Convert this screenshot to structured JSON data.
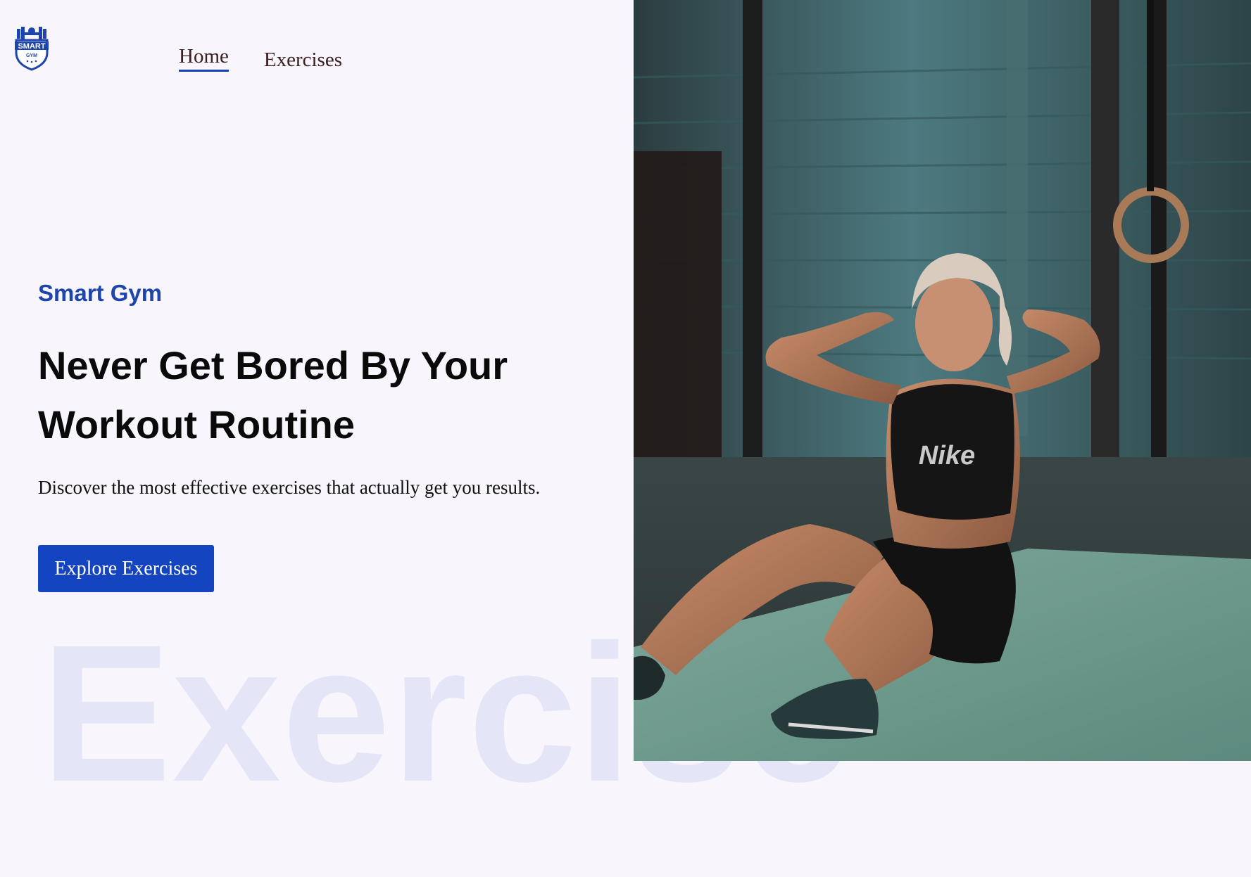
{
  "logo": {
    "text_top": "SMART",
    "text_bottom": "GYM",
    "color": "#1e44ad"
  },
  "nav": {
    "items": [
      {
        "label": "Home",
        "active": true
      },
      {
        "label": "Exercises",
        "active": false
      }
    ]
  },
  "hero": {
    "brand": "Smart Gym",
    "headline_line1": "Never Get Bored By Your",
    "headline_line2": "Workout Routine",
    "description": "Discover the most effective exercises that actually get you results.",
    "cta_label": "Explore Exercises",
    "watermark": "Exercise"
  },
  "photo": {
    "subject": "woman doing sit-ups on gym mat",
    "top_print": "Nike"
  },
  "colors": {
    "accent": "#1444c0",
    "brand_text": "#1e44ad",
    "background": "#f8f6fc",
    "watermark": "#e4e6f8"
  }
}
